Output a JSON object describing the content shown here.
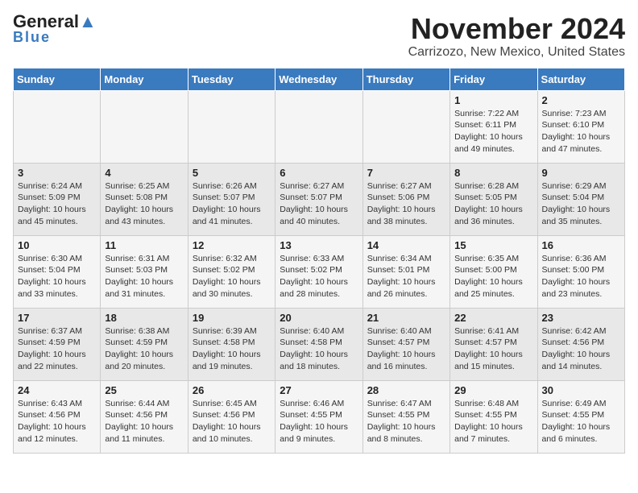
{
  "header": {
    "logo_line1": "General",
    "logo_line2": "Blue",
    "month": "November 2024",
    "location": "Carrizozo, New Mexico, United States"
  },
  "weekdays": [
    "Sunday",
    "Monday",
    "Tuesday",
    "Wednesday",
    "Thursday",
    "Friday",
    "Saturday"
  ],
  "weeks": [
    [
      {
        "day": "",
        "info": ""
      },
      {
        "day": "",
        "info": ""
      },
      {
        "day": "",
        "info": ""
      },
      {
        "day": "",
        "info": ""
      },
      {
        "day": "",
        "info": ""
      },
      {
        "day": "1",
        "info": "Sunrise: 7:22 AM\nSunset: 6:11 PM\nDaylight: 10 hours\nand 49 minutes."
      },
      {
        "day": "2",
        "info": "Sunrise: 7:23 AM\nSunset: 6:10 PM\nDaylight: 10 hours\nand 47 minutes."
      }
    ],
    [
      {
        "day": "3",
        "info": "Sunrise: 6:24 AM\nSunset: 5:09 PM\nDaylight: 10 hours\nand 45 minutes."
      },
      {
        "day": "4",
        "info": "Sunrise: 6:25 AM\nSunset: 5:08 PM\nDaylight: 10 hours\nand 43 minutes."
      },
      {
        "day": "5",
        "info": "Sunrise: 6:26 AM\nSunset: 5:07 PM\nDaylight: 10 hours\nand 41 minutes."
      },
      {
        "day": "6",
        "info": "Sunrise: 6:27 AM\nSunset: 5:07 PM\nDaylight: 10 hours\nand 40 minutes."
      },
      {
        "day": "7",
        "info": "Sunrise: 6:27 AM\nSunset: 5:06 PM\nDaylight: 10 hours\nand 38 minutes."
      },
      {
        "day": "8",
        "info": "Sunrise: 6:28 AM\nSunset: 5:05 PM\nDaylight: 10 hours\nand 36 minutes."
      },
      {
        "day": "9",
        "info": "Sunrise: 6:29 AM\nSunset: 5:04 PM\nDaylight: 10 hours\nand 35 minutes."
      }
    ],
    [
      {
        "day": "10",
        "info": "Sunrise: 6:30 AM\nSunset: 5:04 PM\nDaylight: 10 hours\nand 33 minutes."
      },
      {
        "day": "11",
        "info": "Sunrise: 6:31 AM\nSunset: 5:03 PM\nDaylight: 10 hours\nand 31 minutes."
      },
      {
        "day": "12",
        "info": "Sunrise: 6:32 AM\nSunset: 5:02 PM\nDaylight: 10 hours\nand 30 minutes."
      },
      {
        "day": "13",
        "info": "Sunrise: 6:33 AM\nSunset: 5:02 PM\nDaylight: 10 hours\nand 28 minutes."
      },
      {
        "day": "14",
        "info": "Sunrise: 6:34 AM\nSunset: 5:01 PM\nDaylight: 10 hours\nand 26 minutes."
      },
      {
        "day": "15",
        "info": "Sunrise: 6:35 AM\nSunset: 5:00 PM\nDaylight: 10 hours\nand 25 minutes."
      },
      {
        "day": "16",
        "info": "Sunrise: 6:36 AM\nSunset: 5:00 PM\nDaylight: 10 hours\nand 23 minutes."
      }
    ],
    [
      {
        "day": "17",
        "info": "Sunrise: 6:37 AM\nSunset: 4:59 PM\nDaylight: 10 hours\nand 22 minutes."
      },
      {
        "day": "18",
        "info": "Sunrise: 6:38 AM\nSunset: 4:59 PM\nDaylight: 10 hours\nand 20 minutes."
      },
      {
        "day": "19",
        "info": "Sunrise: 6:39 AM\nSunset: 4:58 PM\nDaylight: 10 hours\nand 19 minutes."
      },
      {
        "day": "20",
        "info": "Sunrise: 6:40 AM\nSunset: 4:58 PM\nDaylight: 10 hours\nand 18 minutes."
      },
      {
        "day": "21",
        "info": "Sunrise: 6:40 AM\nSunset: 4:57 PM\nDaylight: 10 hours\nand 16 minutes."
      },
      {
        "day": "22",
        "info": "Sunrise: 6:41 AM\nSunset: 4:57 PM\nDaylight: 10 hours\nand 15 minutes."
      },
      {
        "day": "23",
        "info": "Sunrise: 6:42 AM\nSunset: 4:56 PM\nDaylight: 10 hours\nand 14 minutes."
      }
    ],
    [
      {
        "day": "24",
        "info": "Sunrise: 6:43 AM\nSunset: 4:56 PM\nDaylight: 10 hours\nand 12 minutes."
      },
      {
        "day": "25",
        "info": "Sunrise: 6:44 AM\nSunset: 4:56 PM\nDaylight: 10 hours\nand 11 minutes."
      },
      {
        "day": "26",
        "info": "Sunrise: 6:45 AM\nSunset: 4:56 PM\nDaylight: 10 hours\nand 10 minutes."
      },
      {
        "day": "27",
        "info": "Sunrise: 6:46 AM\nSunset: 4:55 PM\nDaylight: 10 hours\nand 9 minutes."
      },
      {
        "day": "28",
        "info": "Sunrise: 6:47 AM\nSunset: 4:55 PM\nDaylight: 10 hours\nand 8 minutes."
      },
      {
        "day": "29",
        "info": "Sunrise: 6:48 AM\nSunset: 4:55 PM\nDaylight: 10 hours\nand 7 minutes."
      },
      {
        "day": "30",
        "info": "Sunrise: 6:49 AM\nSunset: 4:55 PM\nDaylight: 10 hours\nand 6 minutes."
      }
    ]
  ]
}
